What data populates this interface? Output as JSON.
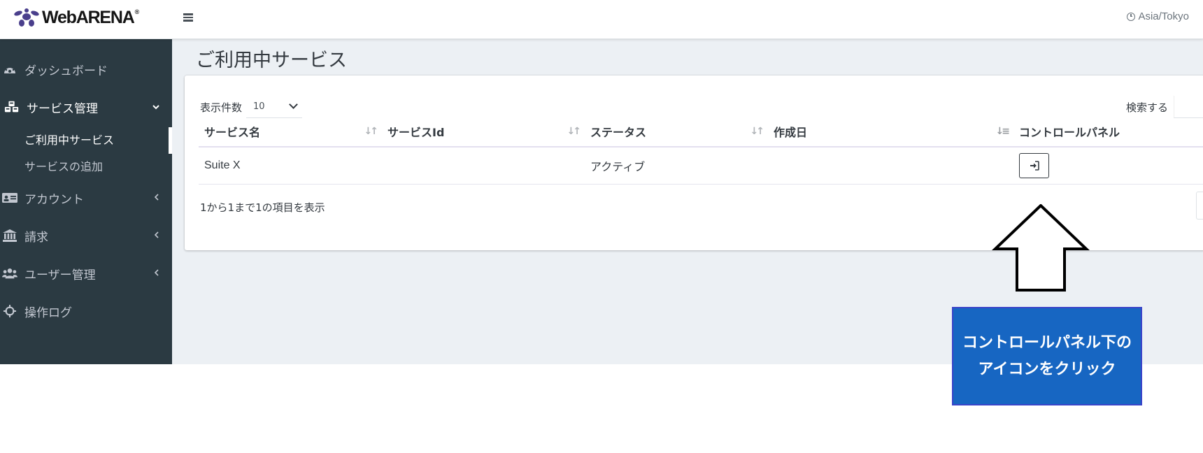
{
  "navbar": {
    "brand": "WebARENA",
    "brand_reg": "®",
    "timezone": "Asia/Tokyo"
  },
  "sidebar": {
    "items": [
      {
        "label": "ダッシュボード",
        "icon": "tachometer-icon"
      },
      {
        "label": "サービス管理",
        "icon": "cubes-icon",
        "expanded": true,
        "children": [
          {
            "label": "ご利用中サービス",
            "active": true
          },
          {
            "label": "サービスの追加"
          }
        ]
      },
      {
        "label": "アカウント",
        "icon": "id-card-icon"
      },
      {
        "label": "請求",
        "icon": "bank-icon"
      },
      {
        "label": "ユーザー管理",
        "icon": "users-icon"
      },
      {
        "label": "操作ログ",
        "icon": "crosshairs-icon"
      }
    ]
  },
  "main": {
    "title": "ご利用中サービス",
    "length_label": "表示件数",
    "length_value": "10",
    "search_label": "検索する",
    "columns": [
      "サービス名",
      "サービスId",
      "ステータス",
      "作成日",
      "コントロールパネル"
    ],
    "rows": [
      {
        "name": "Suite X",
        "id": "",
        "status": "アクティブ",
        "created": ""
      }
    ],
    "info": "1から1まで1の項目を表示"
  },
  "annotation": {
    "line1": "コントロールパネル下の",
    "line2": "アイコンをクリック",
    "box_color": "#1766c2"
  },
  "colors": {
    "sidebar_bg": "#2b3a42",
    "content_bg": "#ecf0f4",
    "annotation_bg": "#1766c2"
  }
}
